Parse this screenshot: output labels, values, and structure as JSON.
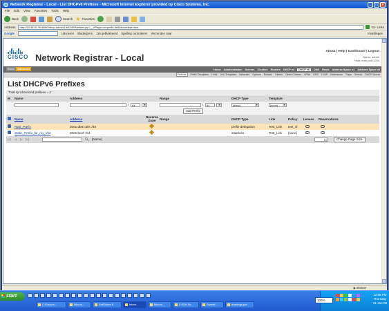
{
  "window": {
    "title": "Network Registrar - Local - List DHCPv6 Prefixes - Microsoft Internet Explorer provided by Cisco Systems, Inc."
  },
  "menu": [
    "File",
    "Edit",
    "View",
    "Favorites",
    "Tools",
    "Help"
  ],
  "toolbar": {
    "back": "Back",
    "search": "Search",
    "favorites": "Favorites"
  },
  "address": {
    "label": "Address",
    "url": "http://10.48.81.99:8080/dhcp-admin/ListCNRPrefixes.jsp?__rfPage=cnrprefix-list&clickedbar=true",
    "go": "Go",
    "links": "Links"
  },
  "google": {
    "label": "Google",
    "uitvoeren": "Uitvoeren",
    "bladwijzers": "Bladwijzers",
    "geblokkeerd": "116 geblokkeerd",
    "spelling": "Spelling controleren",
    "verzenden": "Verzenden naar",
    "instellingen": "Instellingen"
  },
  "app": {
    "logo": "CISCO",
    "title": "Network Registrar - Local",
    "toplinks": "About | Help | Dashboard | Logout",
    "name_line": "Name: admin",
    "host_line": "Host: emb-pc8:1234",
    "mode": [
      "Basic",
      "Advanced"
    ],
    "nav": [
      "Home",
      "Administration",
      "Servers",
      "Clusters",
      "Routers",
      "DHCP v4",
      "DHCP v6",
      "DNS",
      "Hosts",
      "Address Space v4",
      "Address Space v6"
    ],
    "subnav": [
      "Prefixes",
      "Prefix Templates",
      "Links",
      "Link Templates",
      "Networks",
      "Options",
      "Policies",
      "Clients",
      "Client Classes",
      "VPNs",
      "DNS",
      "LDAP",
      "Extensions",
      "Traps",
      "Search",
      "DHCP Server"
    ]
  },
  "page": {
    "heading": "List DHCPv6 Prefixes",
    "total": "Total synchronized prefixes = 2",
    "add_headers": {
      "name": "Name",
      "address": "Address",
      "range": "Range",
      "dhcp_type": "DHCP Type",
      "template": "Template"
    },
    "add_fields": {
      "address_len": "64",
      "range_len": "64",
      "dhcp_type": "[dhcp]",
      "template": "[none]"
    },
    "add_button": "Add Prefix",
    "list_headers": {
      "name": "Name",
      "address": "Address",
      "reverse_zone": "Reverse Zone",
      "range": "Range",
      "dhcp_type": "DHCP Type",
      "link": "Link",
      "policy": "Policy",
      "leases": "Leases",
      "reservations": "Reservations"
    },
    "rows": [
      {
        "name": "Real_Prefix",
        "address": "2001:db8:cafe::/48",
        "dhcp_type": "prefix-delegation",
        "link": "Test_Link",
        "policy": "test_rli"
      },
      {
        "name": "Static_Prefix_for_my_test",
        "address": "2001:beef::/64",
        "dhcp_type": "stateless",
        "link": "Test_Link",
        "policy": "[none]"
      }
    ],
    "pager": {
      "filter_label": "[Name]",
      "page_size": "10",
      "change_button": "Change Page Size"
    }
  },
  "status": {
    "left": "",
    "zone": "Internet"
  },
  "taskbar": {
    "start": "start",
    "tasks": [
      "C:\\Docum...",
      "Micros...",
      "SoftToken II",
      "Intern...",
      "Micros...",
      "2 SSH Se...",
      "Sametl...",
      "drawings.ppt"
    ],
    "percent": "100%",
    "time": "12:55 PM",
    "day": "Thursday",
    "date": "31-Jan-08"
  },
  "colors": {
    "selected_row": "#fde3b8",
    "header_gray": "#d9d9d9",
    "nav_gray": "#6a6a6a",
    "advanced_tab": "#e8a117",
    "link_blue": "#1a3fa8"
  }
}
